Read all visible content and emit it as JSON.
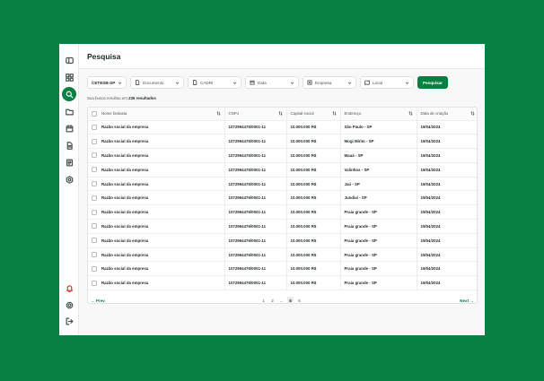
{
  "page_title": "Pesquisa",
  "sidebar": {
    "items": [
      {
        "name": "toggle-sidebar-icon"
      },
      {
        "name": "grid-icon"
      },
      {
        "name": "search-icon",
        "active": true
      },
      {
        "name": "folder-icon"
      },
      {
        "name": "calendar-icon"
      },
      {
        "name": "document-icon"
      },
      {
        "name": "report-icon"
      },
      {
        "name": "settings-cog-icon"
      }
    ],
    "bottom": [
      {
        "name": "bell-icon"
      },
      {
        "name": "gear-icon"
      },
      {
        "name": "logout-icon"
      }
    ]
  },
  "filters": {
    "region": "CETESB-SP",
    "documento": "Documento",
    "cadri": "CADRI",
    "data": "Data",
    "empresa": "Empresa",
    "local": "Local",
    "search_button": "Pesquisar"
  },
  "summary": {
    "prefix": "Sua busca resultou em",
    "count": "235 resultados"
  },
  "table": {
    "columns": [
      "Nome fantasia",
      "CNPJ",
      "Capital social",
      "Endereço",
      "Data de criação"
    ],
    "rows": [
      [
        "Razão social da empresa",
        "1072994476/0001-11",
        "10.000.000 R$",
        "São Paulo - SP",
        "19/04/2024"
      ],
      [
        "Razão social da empresa",
        "1072994476/0001-11",
        "10.000.000 R$",
        "Mogi Mirim - SP",
        "19/04/2024"
      ],
      [
        "Razão social da empresa",
        "1072994476/0001-11",
        "10.000.000 R$",
        "Mauá - SP",
        "19/04/2024"
      ],
      [
        "Razão social da empresa",
        "1072994476/0001-11",
        "10.000.000 R$",
        "Valinhos - SP",
        "19/04/2024"
      ],
      [
        "Razão social da empresa",
        "1072994476/0001-11",
        "10.000.000 R$",
        "Jaú - SP",
        "19/04/2024"
      ],
      [
        "Razão social da empresa",
        "1072994476/0001-11",
        "10.000.000 R$",
        "Jundiaí - SP",
        "19/04/2024"
      ],
      [
        "Razão social da empresa",
        "1072994476/0001-11",
        "10.000.000 R$",
        "Praia grande - SP",
        "19/04/2024"
      ],
      [
        "Razão social da empresa",
        "1072994476/0001-11",
        "10.000.000 R$",
        "Praia grande - SP",
        "19/04/2024"
      ],
      [
        "Razão social da empresa",
        "1072994476/0001-11",
        "10.000.000 R$",
        "Praia grande - SP",
        "19/04/2024"
      ],
      [
        "Razão social da empresa",
        "1072994476/0001-11",
        "10.000.000 R$",
        "Praia grande - SP",
        "19/04/2024"
      ],
      [
        "Razão social da empresa",
        "1072994476/0001-11",
        "10.000.000 R$",
        "Praia grande - SP",
        "19/04/2024"
      ],
      [
        "Razão social da empresa",
        "1072994476/0001-11",
        "10.000.000 R$",
        "Praia grande - SP",
        "19/04/2024"
      ]
    ]
  },
  "pagination": {
    "prev": "Prev",
    "next": "Next",
    "pages": [
      "1",
      "2",
      "...",
      "5",
      "6"
    ],
    "current": "5"
  },
  "colors": {
    "brand": "#078043",
    "alert": "#d9342b"
  }
}
